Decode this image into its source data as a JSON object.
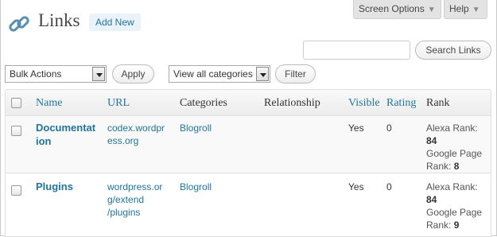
{
  "header": {
    "title": "Links",
    "add_new_label": "Add New",
    "screen_options_label": "Screen Options",
    "help_label": "Help"
  },
  "search": {
    "input_value": "",
    "button_label": "Search Links"
  },
  "toolbar": {
    "bulk_actions_selected": "Bulk Actions",
    "apply_label": "Apply",
    "category_selected": "View all categories",
    "filter_label": "Filter"
  },
  "table": {
    "columns": [
      "Name",
      "URL",
      "Categories",
      "Relationship",
      "Visible",
      "Rating",
      "Rank"
    ],
    "rows": [
      {
        "name_line1": "Documentat",
        "name_line2": "ion",
        "url_line1": "codex.wordpr",
        "url_line2": "ess.org",
        "url_line3": "",
        "category": "Blogroll",
        "relationship": "",
        "visible": "Yes",
        "rating": "0",
        "alexa_label": "Alexa Rank:",
        "alexa_value": "84",
        "google_label1": "Google Page",
        "google_label2": "Rank:",
        "google_value": "8"
      },
      {
        "name_line1": "Plugins",
        "name_line2": "",
        "url_line1": "wordpress.or",
        "url_line2": "g/extend",
        "url_line3": "/plugins",
        "category": "Blogroll",
        "relationship": "",
        "visible": "Yes",
        "rating": "0",
        "alexa_label": "Alexa Rank:",
        "alexa_value": "84",
        "google_label1": "Google Page",
        "google_label2": "Rank:",
        "google_value": "9"
      }
    ]
  },
  "icons": {
    "title_icon": "links-chain-icon",
    "dropdown_icon": "chevron-down-icon"
  },
  "colors": {
    "link": "#21759b",
    "header_bg": "#ececec",
    "row_alt_bg": "#f9f9f9"
  }
}
